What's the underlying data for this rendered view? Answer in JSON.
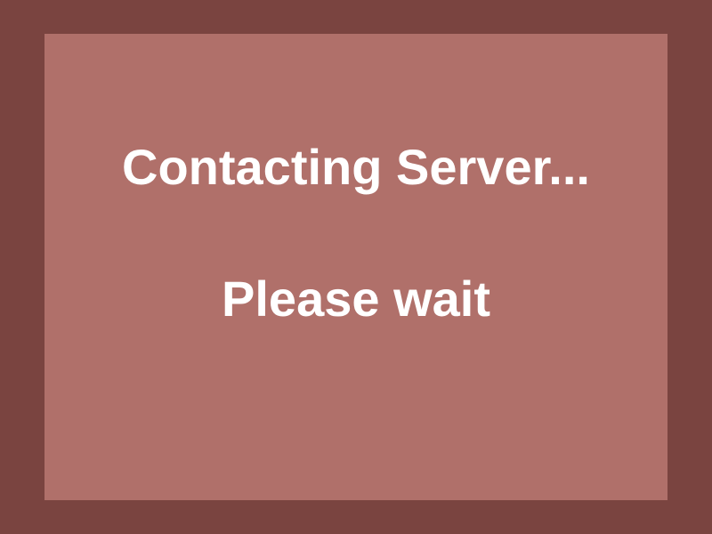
{
  "dialog": {
    "title": "Contacting Server...",
    "message": "Please wait"
  },
  "colors": {
    "background": "#7a4440",
    "panel": "#b0706a",
    "text": "#ffffff"
  }
}
